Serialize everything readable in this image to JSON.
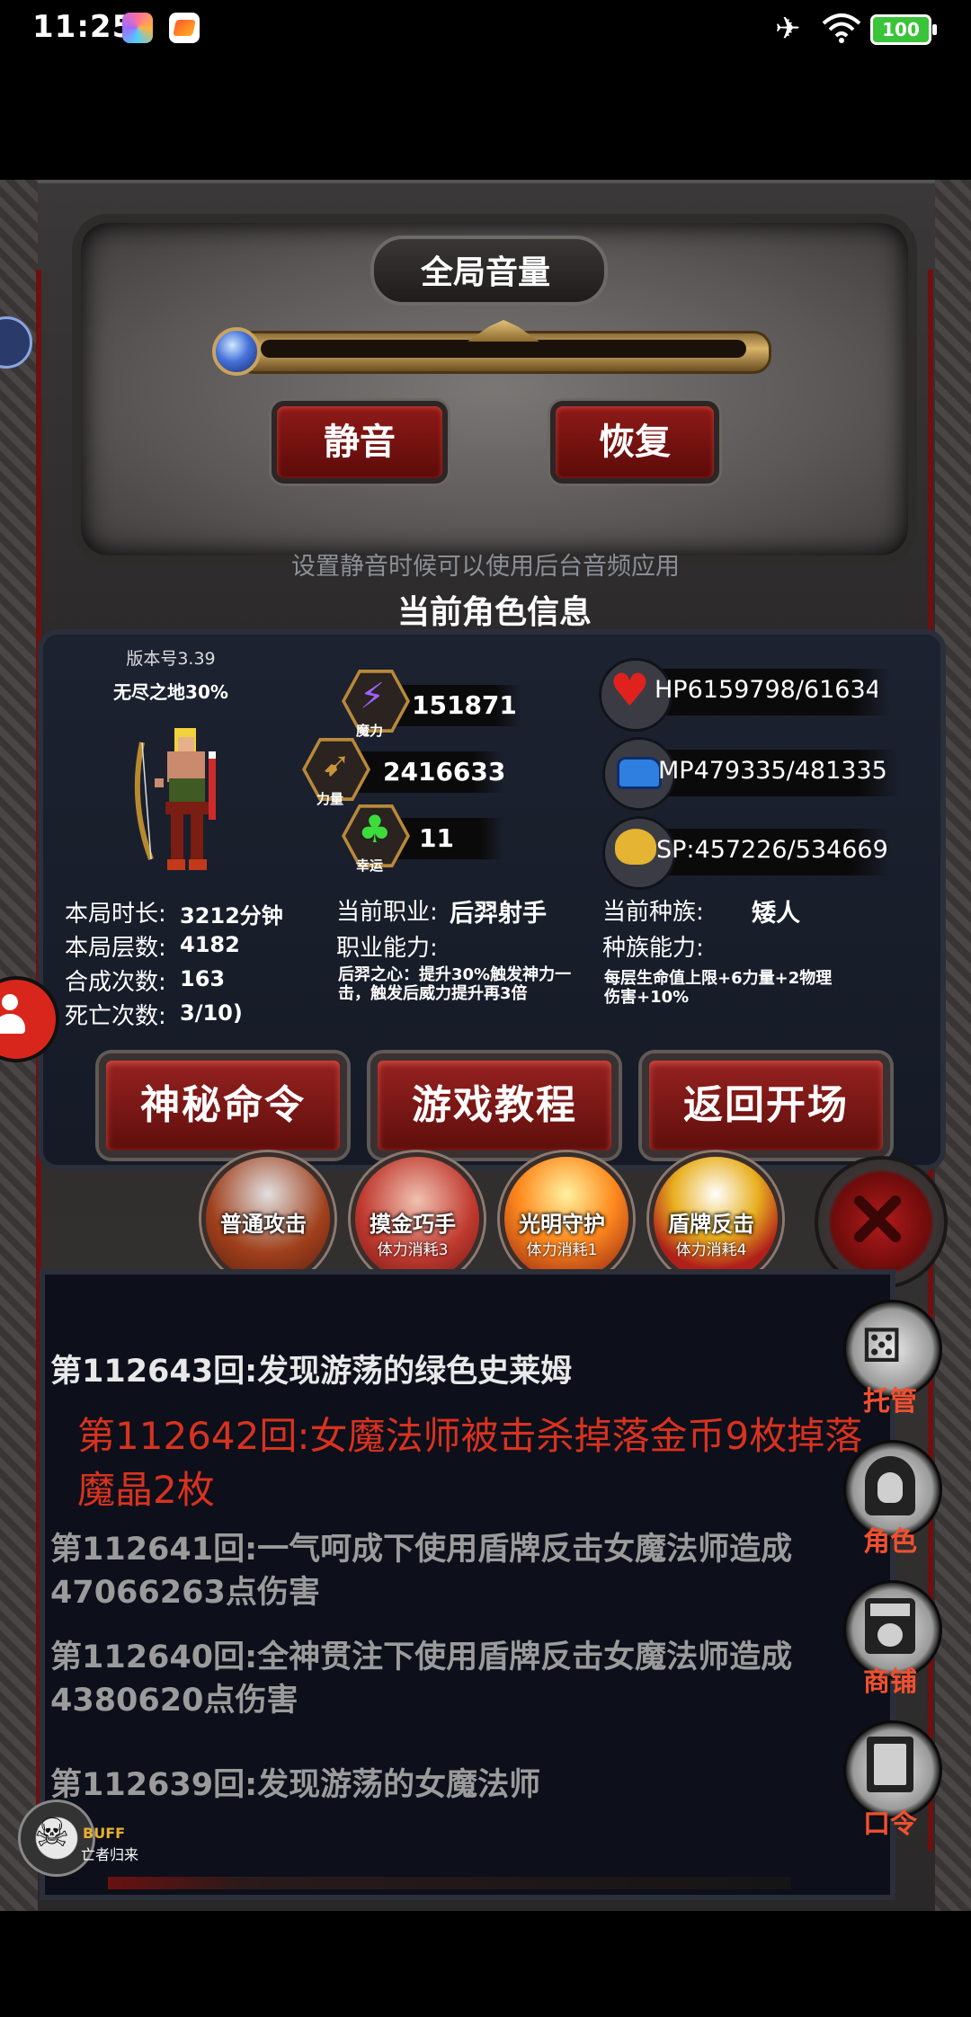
{
  "status_bar": {
    "time": "11:25",
    "battery": "100"
  },
  "volume": {
    "title": "全局音量",
    "mute_label": "静音",
    "restore_label": "恢复",
    "hint": "设置静音时候可以使用后台音频应用"
  },
  "character": {
    "title": "当前角色信息",
    "version": "版本号3.39",
    "endless": "无尽之地30%",
    "stats": {
      "magic_label": "魔力",
      "magic": "151871",
      "strength_label": "力量",
      "strength": "2416633",
      "luck_label": "幸运",
      "luck": "11"
    },
    "resources": {
      "hp": "HP6159798/61634",
      "mp": "MP479335/481335",
      "sp": "SP:457226/534669"
    },
    "info": {
      "duration_label": "本局时长:",
      "duration": "3212分钟",
      "floors_label": "本局层数:",
      "floors": "4182",
      "synth_label": "合成次数:",
      "synth": "163",
      "deaths_label": "死亡次数:",
      "deaths": "3/10)",
      "job_label": "当前职业:",
      "job": "后羿射手",
      "job_ability_label": "职业能力:",
      "job_ability": "后羿之心：提升30%触发神力一击，触发后威力提升再3倍",
      "race_label": "当前种族:",
      "race": "矮人",
      "race_ability_label": "种族能力:",
      "race_ability": "每层生命值上限+6力量+2物理伤害+10%"
    },
    "buttons": {
      "secret": "神秘命令",
      "tutorial": "游戏教程",
      "back": "返回开场"
    }
  },
  "skills": [
    {
      "name": "普通攻击",
      "cost": ""
    },
    {
      "name": "摸金巧手",
      "cost": "体力消耗3"
    },
    {
      "name": "光明守护",
      "cost": "体力消耗1"
    },
    {
      "name": "盾牌反击",
      "cost": "体力消耗4"
    }
  ],
  "log": [
    {
      "text": "第112643回:发现游荡的绿色史莱姆"
    },
    {
      "text": "第112642回:女魔法师被击杀掉落金币9枚掉落魔晶2枚"
    },
    {
      "text": "第112641回:一气呵成下使用盾牌反击女魔法师造成47066263点伤害"
    },
    {
      "text": "第112640回:全神贯注下使用盾牌反击女魔法师造成4380620点伤害"
    },
    {
      "text": "第112639回:发现游荡的女魔法师"
    }
  ],
  "side_menu": {
    "auto": "托管",
    "role": "角色",
    "shop": "商铺",
    "code": "口令"
  },
  "buff": {
    "label": "BUFF",
    "name": "亡者归来"
  },
  "colors": {
    "log_default": "#e8e8e8",
    "log_drop": "#d8321f",
    "log_damage": "#9b9b9b"
  }
}
